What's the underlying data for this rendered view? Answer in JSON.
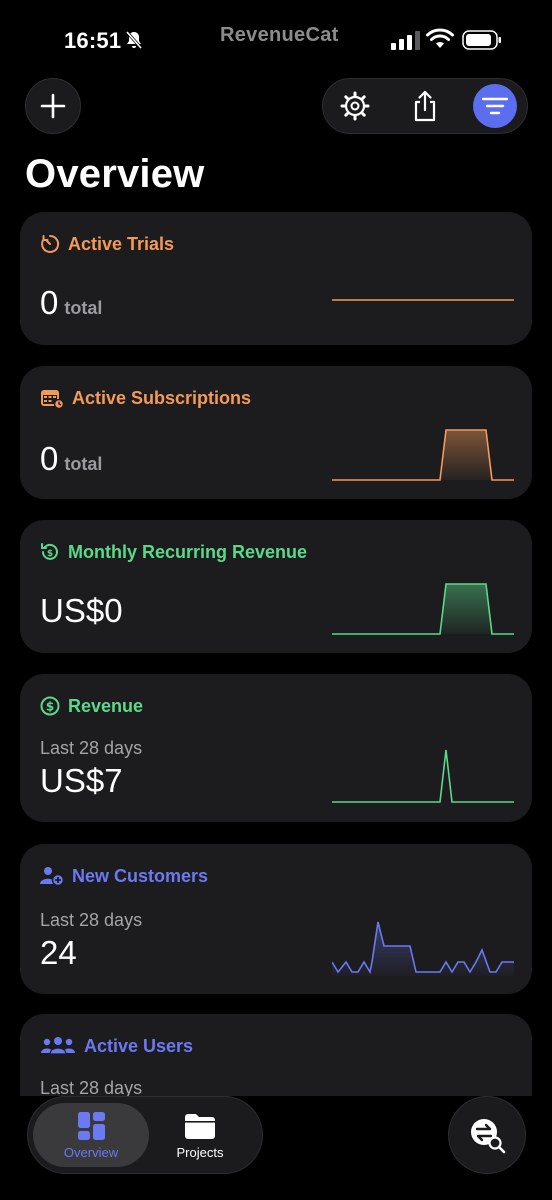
{
  "status_bar": {
    "time": "16:51",
    "brand": "RevenueCat"
  },
  "header": {
    "title": "Overview",
    "icons": [
      "plus-icon",
      "gear-icon",
      "share-icon",
      "filter-icon"
    ]
  },
  "colors": {
    "orange": "#f39a5a",
    "green": "#5bd889",
    "blue": "#6b79f2",
    "card_bg": "#1c1c1e"
  },
  "cards": [
    {
      "title": "Active Trials",
      "value": "0",
      "unit": "total",
      "icon": "timer-icon"
    },
    {
      "title": "Active Subscriptions",
      "value": "0",
      "unit": "total",
      "icon": "calendar-icon"
    },
    {
      "title": "Monthly Recurring Revenue",
      "value": "US$0",
      "icon": "recurring-dollar-icon"
    },
    {
      "title": "Revenue",
      "subtitle": "Last 28 days",
      "value": "US$7",
      "icon": "dollar-circle-icon"
    },
    {
      "title": "New Customers",
      "subtitle": "Last 28 days",
      "value": "24",
      "icon": "add-user-icon"
    },
    {
      "title": "Active Users",
      "subtitle": "Last 28 days",
      "icon": "users-icon"
    }
  ],
  "tabbar": {
    "tabs": [
      {
        "label": "Overview",
        "active": true
      },
      {
        "label": "Projects",
        "active": false
      }
    ]
  }
}
